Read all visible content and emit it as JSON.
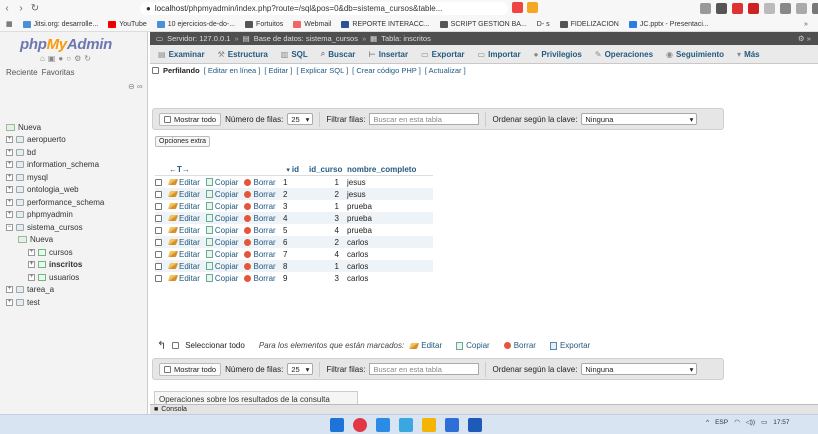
{
  "browser": {
    "url_prefix": "localhost",
    "url": "/phpmyadmin/index.php?route=/sql&pos=0&db=sistema_cursos&table...",
    "bookmarks": [
      "Jitsi.org: desarrolle...",
      "YouTube",
      "10 ejercicios-de-do-...",
      "Fortuitos",
      "Webmail",
      "REPORTE INTERACC...",
      "SCRIPT GESTION BA...",
      "D- s",
      "FIDELIZACION",
      "JC.pptx - Presentaci..."
    ]
  },
  "sidebar": {
    "logo_php": "php",
    "logo_my": "My",
    "logo_admin": "Admin",
    "tab_recent": "Reciente",
    "tab_favorites": "Favoritas",
    "tree": [
      {
        "label": "Nueva",
        "level": 0,
        "type": "new"
      },
      {
        "label": "aeropuerto",
        "level": 0,
        "type": "db"
      },
      {
        "label": "bd",
        "level": 0,
        "type": "db"
      },
      {
        "label": "information_schema",
        "level": 0,
        "type": "db"
      },
      {
        "label": "mysql",
        "level": 0,
        "type": "db"
      },
      {
        "label": "ontologia_web",
        "level": 0,
        "type": "db"
      },
      {
        "label": "performance_schema",
        "level": 0,
        "type": "db"
      },
      {
        "label": "phpmyadmin",
        "level": 0,
        "type": "db"
      },
      {
        "label": "sistema_cursos",
        "level": 0,
        "type": "db"
      },
      {
        "label": "Nueva",
        "level": 1,
        "type": "new"
      },
      {
        "label": "cursos",
        "level": 2,
        "type": "table"
      },
      {
        "label": "inscritos",
        "level": 2,
        "type": "table"
      },
      {
        "label": "usuarios",
        "level": 2,
        "type": "table"
      },
      {
        "label": "tarea_a",
        "level": 0,
        "type": "db"
      },
      {
        "label": "test",
        "level": 0,
        "type": "db"
      }
    ]
  },
  "breadcrumb": {
    "server": "Servidor: 127.0.0.1",
    "database": "Base de datos: sistema_cursos",
    "table": "Tabla: inscritos"
  },
  "tabs": [
    "Examinar",
    "Estructura",
    "SQL",
    "Buscar",
    "Insertar",
    "Exportar",
    "Importar",
    "Privilegios",
    "Operaciones",
    "Seguimiento",
    "Más"
  ],
  "profiling": {
    "label": "Perfilando",
    "links": [
      "[ Editar en línea ]",
      "[ Editar ]",
      "[ Explicar SQL ]",
      "[ Crear código PHP ]",
      "[ Actualizar ]"
    ]
  },
  "nav": {
    "show_all": "Mostrar todo",
    "rows_label": "Número de filas:",
    "rows_value": "25",
    "filter_label": "Filtrar filas:",
    "filter_placeholder": "Buscar en esta tabla",
    "sort_label": "Ordenar según la clave:",
    "sort_value": "Ninguna"
  },
  "extra_options": "Opciones extra",
  "table": {
    "arrows": "←T→",
    "columns": [
      "id",
      "id_curso",
      "nombre_completo"
    ],
    "actions": [
      "Editar",
      "Copiar",
      "Borrar"
    ],
    "rows": [
      {
        "id": "1",
        "id_curso": "1",
        "nombre": "jesus"
      },
      {
        "id": "2",
        "id_curso": "2",
        "nombre": "jesus"
      },
      {
        "id": "3",
        "id_curso": "1",
        "nombre": "prueba"
      },
      {
        "id": "4",
        "id_curso": "3",
        "nombre": "prueba"
      },
      {
        "id": "5",
        "id_curso": "4",
        "nombre": "prueba"
      },
      {
        "id": "6",
        "id_curso": "2",
        "nombre": "carlos"
      },
      {
        "id": "7",
        "id_curso": "4",
        "nombre": "carlos"
      },
      {
        "id": "8",
        "id_curso": "1",
        "nombre": "carlos"
      },
      {
        "id": "9",
        "id_curso": "3",
        "nombre": "carlos"
      }
    ]
  },
  "bulk": {
    "select_all": "Seleccionar todo",
    "hint": "Para los elementos que están marcados:",
    "edit": "Editar",
    "copy": "Copiar",
    "delete": "Borrar",
    "export": "Exportar"
  },
  "ops_title": "Operaciones sobre los resultados de la consulta",
  "console": "Consola",
  "tray": {
    "lang": "ESP",
    "time": "17:57"
  }
}
